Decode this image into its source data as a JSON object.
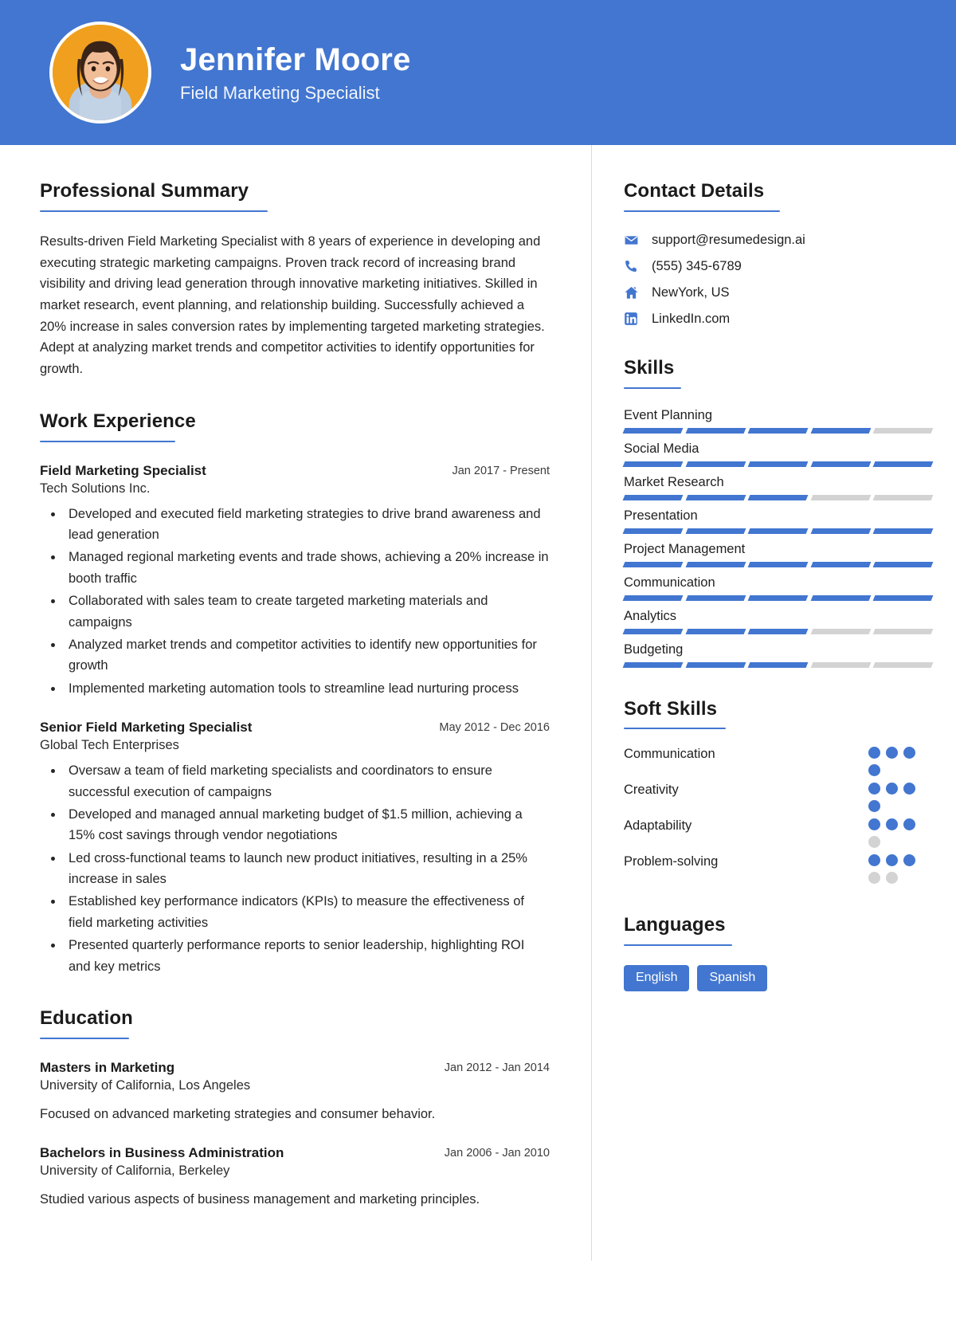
{
  "theme": {
    "accent": "#4276d0",
    "muted": "#d3d3d3",
    "avatar_bg": "#f0a01e"
  },
  "header": {
    "name": "Jennifer Moore",
    "job_title": "Field Marketing Specialist",
    "avatar_alt": "profile-photo"
  },
  "summary": {
    "heading": "Professional Summary",
    "text": "Results-driven Field Marketing Specialist with 8 years of experience in developing and executing strategic marketing campaigns. Proven track record of increasing brand visibility and driving lead generation through innovative marketing initiatives. Skilled in market research, event planning, and relationship building. Successfully achieved a 20% increase in sales conversion rates by implementing targeted marketing strategies. Adept at analyzing market trends and competitor activities to identify opportunities for growth."
  },
  "work": {
    "heading": "Work Experience",
    "entries": [
      {
        "role": "Field Marketing Specialist",
        "org": "Tech Solutions Inc.",
        "date": "Jan 2017 - Present",
        "bullets": [
          "Developed and executed field marketing strategies to drive brand awareness and lead generation",
          "Managed regional marketing events and trade shows, achieving a 20% increase in booth traffic",
          "Collaborated with sales team to create targeted marketing materials and campaigns",
          "Analyzed market trends and competitor activities to identify new opportunities for growth",
          "Implemented marketing automation tools to streamline lead nurturing process"
        ]
      },
      {
        "role": "Senior Field Marketing Specialist",
        "org": "Global Tech Enterprises",
        "date": "May 2012 - Dec 2016",
        "bullets": [
          "Oversaw a team of field marketing specialists and coordinators to ensure successful execution of campaigns",
          "Developed and managed annual marketing budget of $1.5 million, achieving a 15% cost savings through vendor negotiations",
          "Led cross-functional teams to launch new product initiatives, resulting in a 25% increase in sales",
          "Established key performance indicators (KPIs) to measure the effectiveness of field marketing activities",
          "Presented quarterly performance reports to senior leadership, highlighting ROI and key metrics"
        ]
      }
    ]
  },
  "education": {
    "heading": "Education",
    "entries": [
      {
        "degree": "Masters in Marketing",
        "school": "University of California, Los Angeles",
        "date": "Jan 2012 - Jan 2014",
        "description": "Focused on advanced marketing strategies and consumer behavior."
      },
      {
        "degree": "Bachelors in Business Administration",
        "school": "University of California, Berkeley",
        "date": "Jan 2006 - Jan 2010",
        "description": "Studied various aspects of business management and marketing principles."
      }
    ]
  },
  "contact": {
    "heading": "Contact Details",
    "items": [
      {
        "icon": "envelope-icon",
        "value": "support@resumedesign.ai"
      },
      {
        "icon": "phone-icon",
        "value": "(555) 345-6789"
      },
      {
        "icon": "home-icon",
        "value": "NewYork, US"
      },
      {
        "icon": "linkedin-icon",
        "value": "LinkedIn.com"
      }
    ]
  },
  "skills": {
    "heading": "Skills",
    "segments_total": 5,
    "items": [
      {
        "name": "Event Planning",
        "filled": 4
      },
      {
        "name": "Social Media",
        "filled": 5
      },
      {
        "name": "Market Research",
        "filled": 3
      },
      {
        "name": "Presentation",
        "filled": 5
      },
      {
        "name": "Project Management",
        "filled": 5
      },
      {
        "name": "Communication",
        "filled": 5
      },
      {
        "name": "Analytics",
        "filled": 3
      },
      {
        "name": "Budgeting",
        "filled": 3
      }
    ]
  },
  "soft_skills": {
    "heading": "Soft Skills",
    "dots_total": 4,
    "items": [
      {
        "name": "Communication",
        "filled": 4
      },
      {
        "name": "Creativity",
        "filled": 4
      },
      {
        "name": "Adaptability",
        "filled": 3
      },
      {
        "name": "Problem-solving",
        "filled": 3,
        "dots_total": 5
      }
    ]
  },
  "languages": {
    "heading": "Languages",
    "items": [
      "English",
      "Spanish"
    ]
  }
}
